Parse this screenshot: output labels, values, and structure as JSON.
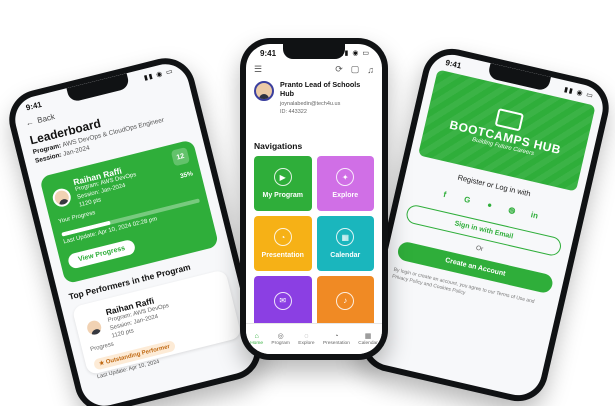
{
  "left_phone": {
    "status_time": "9:41",
    "back_label": "Back",
    "title": "Leaderboard",
    "program_label": "Program:",
    "program_value": "AWS DevOps & CloudOps Engineer",
    "session_label": "Session:",
    "session_value": "Jan-2024",
    "rank": "12",
    "user_name": "Raihan Raffi",
    "user_program": "Program: AWS DevOps",
    "user_session": "Session: Jan-2024",
    "user_points": "1120 pts",
    "progress_pct": "35%",
    "progress_value": 0.35,
    "progress_label": "Your Progress",
    "last_update": "Last Update: Apr 10, 2024 02:28 pm",
    "view_button": "View Progress",
    "top_performers_title": "Top Performers in the Program",
    "performer": {
      "name": "Raihan Raffi",
      "program": "Program: AWS DevOps",
      "session": "Session: Jan-2024",
      "points": "1120 pts",
      "progress_label": "Progress",
      "badge": "Outstanding Performer",
      "last_update": "Last Update: Apr 10, 2024"
    }
  },
  "center_phone": {
    "status_time": "9:41",
    "profile_name": "Pranto Lead of Schools Hub",
    "profile_email": "joynalabedin@tech4u.us",
    "profile_id": "ID: 443322",
    "nav_title": "Navigations",
    "tiles": [
      {
        "label": "My Program",
        "color": "#2fae3a",
        "icon": "play-icon"
      },
      {
        "label": "Explore",
        "color": "#d06fe6",
        "icon": "compass-icon"
      },
      {
        "label": "Presentation",
        "color": "#f6b116",
        "icon": "presentation-icon"
      },
      {
        "label": "Calendar",
        "color": "#1ab6bd",
        "icon": "calendar-icon"
      },
      {
        "label": "",
        "color": "#8b3fe3",
        "icon": "message-icon"
      },
      {
        "label": "",
        "color": "#f08a24",
        "icon": "bell-icon"
      }
    ],
    "tabs": [
      {
        "label": "Home",
        "icon": "home-icon"
      },
      {
        "label": "Program",
        "icon": "program-icon"
      },
      {
        "label": "Explore",
        "icon": "compass-icon"
      },
      {
        "label": "Presentation",
        "icon": "presentation-icon"
      },
      {
        "label": "Calendar",
        "icon": "calendar-icon"
      }
    ]
  },
  "right_phone": {
    "status_time": "9:41",
    "brand": "BOOTCAMPS HUB",
    "tagline": "Building Future Careers",
    "register_title": "Register or Log in with",
    "social": [
      "f",
      "G",
      "",
      "",
      "in"
    ],
    "signin_email": "Sign in with Email",
    "or_label": "Or",
    "create_account": "Create an Account",
    "terms": "By login or create an account, you agree to our Terms of Use and Privacy Policy and Cookies Policy"
  },
  "colors": {
    "brand_green": "#2fae3a",
    "phone_frame": "#101214"
  }
}
